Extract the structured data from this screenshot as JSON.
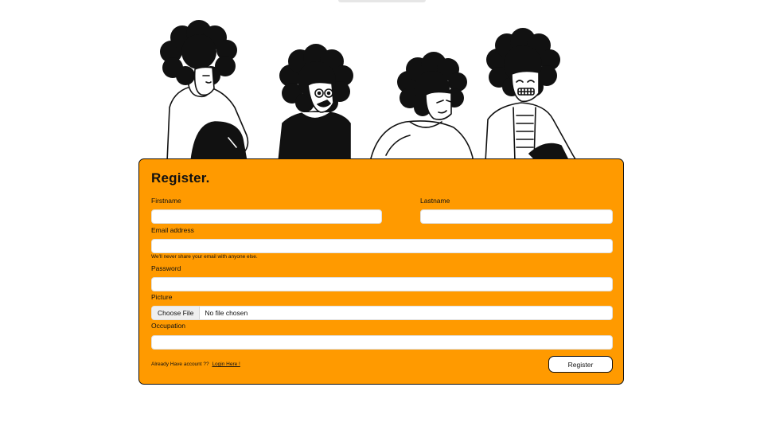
{
  "form": {
    "title": "Register.",
    "firstname": {
      "label": "Firstname",
      "value": "",
      "placeholder": ""
    },
    "lastname": {
      "label": "Lastname",
      "value": "",
      "placeholder": ""
    },
    "email": {
      "label": "Email address",
      "value": "",
      "placeholder": "",
      "help": "We'll never share your email with anyone else."
    },
    "password": {
      "label": "Password",
      "value": "",
      "placeholder": ""
    },
    "picture": {
      "label": "Picture",
      "button": "Choose File",
      "status": "No file chosen"
    },
    "occupation": {
      "label": "Occupation",
      "value": "",
      "placeholder": ""
    },
    "footer": {
      "prompt": "Already Have account ?? ",
      "login_link": "Login Here !"
    },
    "submit_label": "Register"
  },
  "colors": {
    "card_background": "#ff9a00",
    "border": "#111111",
    "input_background": "#ffffff"
  },
  "illustration": {
    "description_icon": "group-of-four-people-icon"
  }
}
